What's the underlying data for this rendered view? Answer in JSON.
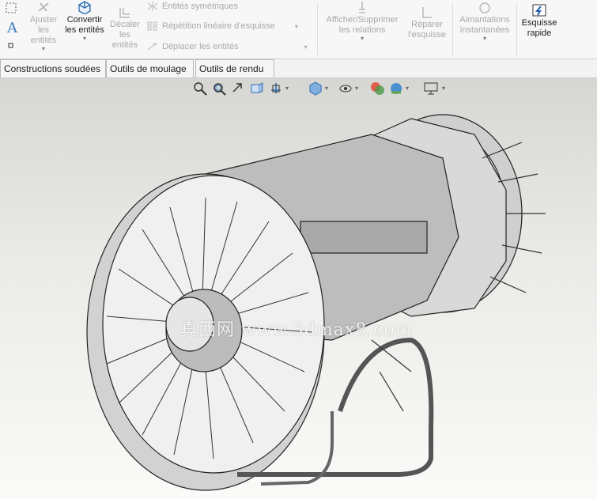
{
  "ribbon": {
    "ajuster": "Ajuster les entités",
    "convertir": "Convertir les entités",
    "decaler": "Décaler les entités",
    "symetriques": "Entités symétriques",
    "repetition": "Répétition linéaire d'esquisse",
    "deplacer": "Déplacer les entités",
    "afficher": "Afficher/Supprimer les relations",
    "reparer": "Réparer l'esquisse",
    "aimantations": "Aimantations instantanées",
    "esquisse_rapide": "Esquisse rapide"
  },
  "tabs": [
    "Constructions soudées",
    "Outils de moulage",
    "Outils de rendu"
  ],
  "viewport": {
    "watermark": "真西网 www.3dmax8.com"
  },
  "colors": {
    "accent": "#2b6cb0",
    "disabled": "#a9a9a9",
    "tab_border": "#b9b9b9"
  }
}
